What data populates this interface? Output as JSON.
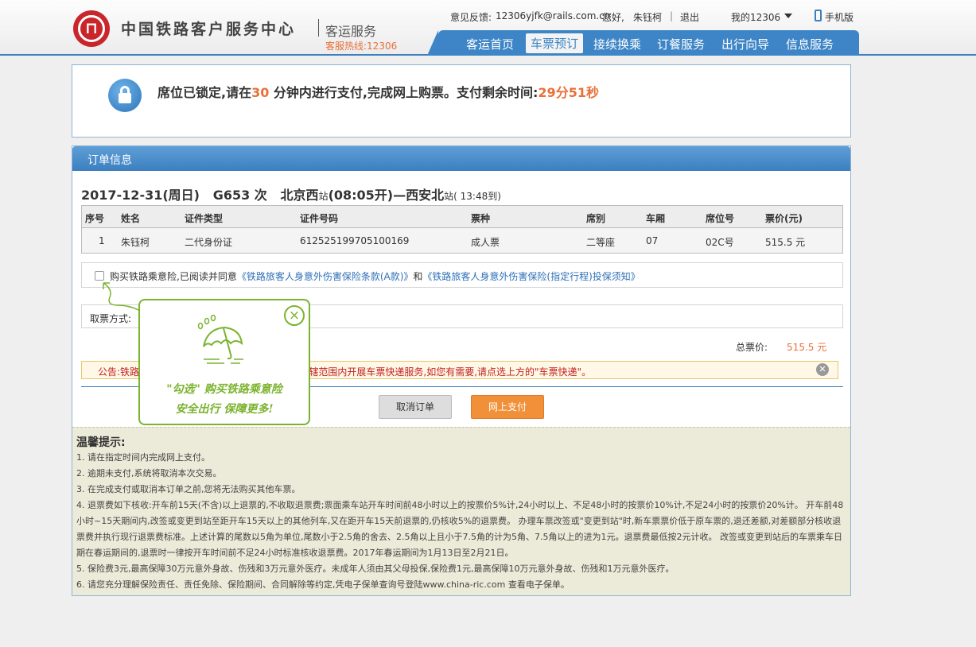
{
  "header": {
    "site_title": "中国铁路客户服务中心",
    "subtitle": "客运服务",
    "hotline": "客服热线:12306",
    "feedback_label": "意见反馈:",
    "feedback_email": "12306yjfk@rails.com.cn",
    "greeting": "您好,",
    "user_name": "朱钰柯",
    "separator": "|",
    "logout": "退出",
    "my12306": "我的12306",
    "mobile": "手机版",
    "nav": [
      "客运首页",
      "车票预订",
      "接续换乘",
      "订餐服务",
      "出行向导",
      "信息服务"
    ],
    "active_nav": "车票预订"
  },
  "lock": {
    "text_prefix": "席位已锁定,请在",
    "minutes": "30",
    "text_middle": " 分钟内进行支付,完成网上购票。支付剩余时间:",
    "remaining": "29分51秒"
  },
  "order": {
    "title": "订单信息",
    "trip_date": "2017-12-31(周日)",
    "train": "G653 次",
    "from": "北京西",
    "station_suffix": "站",
    "depart": "(08:05开)—",
    "to": "西安北",
    "arrive": "( 13:48到)",
    "columns": [
      "序号",
      "姓名",
      "证件类型",
      "证件号码",
      "票种",
      "席别",
      "车厢",
      "席位号",
      "票价(元)"
    ],
    "rows": [
      [
        "1",
        "朱钰柯",
        "二代身份证",
        "612525199705100169",
        "成人票",
        "二等座",
        "07",
        "02C号",
        "515.5 元"
      ]
    ],
    "insurance_prefix": "购买铁路乘意险,已阅读并同意",
    "insurance_link1": "《铁路旅客人身意外伤害保险条款(A款)》",
    "insurance_and": "和",
    "insurance_link2": "《铁路旅客人身意外伤害保险(指定行程)投保须知》",
    "pickup_label": "取票方式:",
    "total_label": "总票价:",
    "total_value": "515.5 元",
    "notice_text": "公告:铁路局、广州铁路(集团)公司、成都铁路局管辖范围内开展车票快递服务,如您有需要,请点选上方的\"车票快递\"。",
    "cancel_button": "取消订单",
    "pay_button": "网上支付"
  },
  "tips": {
    "title": "温馨提示:",
    "items": [
      "1. 请在指定时间内完成网上支付。",
      "2. 逾期未支付,系统将取消本次交易。",
      "3. 在完成支付或取消本订单之前,您将无法购买其他车票。",
      "4. 退票费如下核收:开车前15天(不含)以上退票的,不收取退票费;票面乘车站开车时间前48小时以上的按票价5%计,24小时以上、不足48小时的按票价10%计,不足24小时的按票价20%计。 开车前48小时~15天期间内,改签或变更到站至距开车15天以上的其他列车,又在距开车15天前退票的,仍核收5%的退票费。 办理车票改签或\"变更到站\"时,新车票票价低于原车票的,退还差额,对差额部分核收退票费并执行现行退票费标准。上述计算的尾数以5角为单位,尾数小于2.5角的舍去、2.5角以上且小于7.5角的计为5角、7.5角以上的进为1元。退票费最低按2元计收。 改签或变更到站后的车票乘车日期在春运期间的,退票时一律按开车时间前不足24小时标准核收退票费。2017年春运期间为1月13日至2月21日。",
      "5. 保险费3元,最高保障30万元意外身故、伤残和3万元意外医疗。未成年人须由其父母投保,保险费1元,最高保障10万元意外身故、伤残和1万元意外医疗。",
      "6. 请您充分理解保险责任、责任免除、保险期间、合同解除等约定,凭电子保单查询号登陆www.china-ric.com 查看电子保单。"
    ]
  },
  "popup": {
    "line1": "\"勾选\" 购买铁路乘意险",
    "line2": "安全出行  保障更多!",
    "close": "×"
  },
  "colors": {
    "brand_blue": "#3d85c6",
    "accent_orange": "#e8703a",
    "popup_green": "#7bb32e",
    "logo_red": "#c8262b"
  }
}
